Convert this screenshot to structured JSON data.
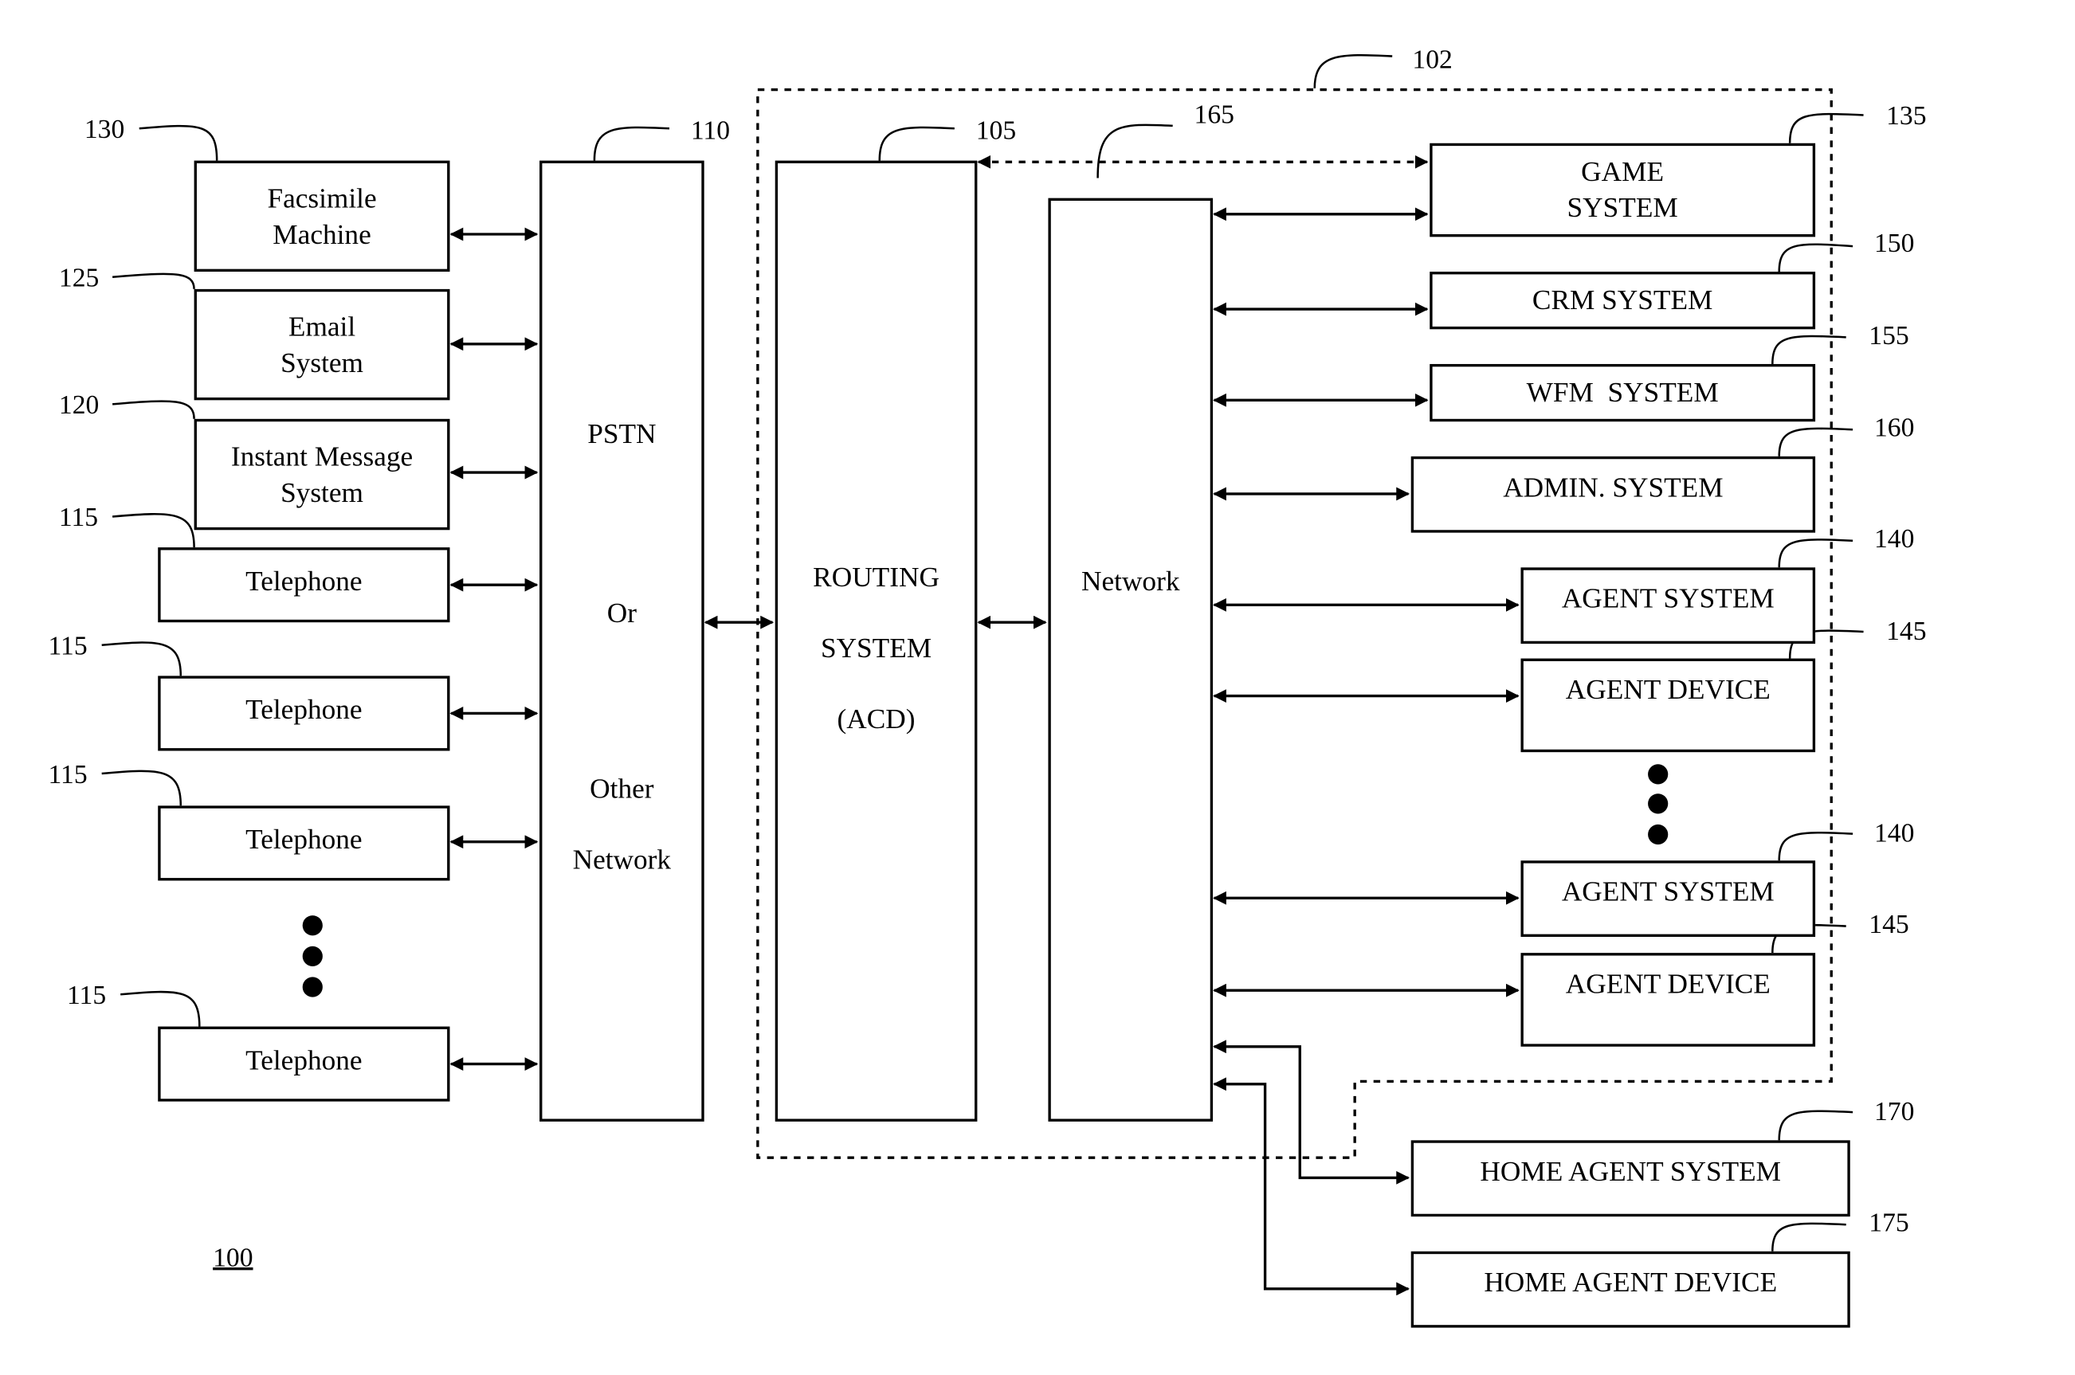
{
  "figure_label": "100",
  "boundary_ref": "102",
  "left_devices": [
    {
      "label": "Facsimile\nMachine",
      "ref": "130"
    },
    {
      "label": "Email\nSystem",
      "ref": "125"
    },
    {
      "label": "Instant Message\nSystem",
      "ref": "120"
    },
    {
      "label": "Telephone",
      "ref": "115"
    },
    {
      "label": "Telephone",
      "ref": "115"
    },
    {
      "label": "Telephone",
      "ref": "115"
    },
    {
      "label": "Telephone",
      "ref": "115"
    }
  ],
  "pstn": {
    "ref": "110",
    "lines": [
      "PSTN",
      "Or",
      "Other",
      "Network"
    ]
  },
  "routing": {
    "ref": "105",
    "lines": [
      "ROUTING",
      "SYSTEM",
      "(ACD)"
    ]
  },
  "network": {
    "ref": "165",
    "label": "Network"
  },
  "right_systems": [
    {
      "label": "GAME\nSYSTEM",
      "ref": "135"
    },
    {
      "label": "CRM SYSTEM",
      "ref": "150"
    },
    {
      "label": "WFM  SYSTEM",
      "ref": "155"
    },
    {
      "label": "ADMIN. SYSTEM",
      "ref": "160"
    },
    {
      "label": "AGENT SYSTEM",
      "ref": "140"
    },
    {
      "label": "AGENT DEVICE",
      "ref": "145"
    },
    {
      "label": "AGENT SYSTEM",
      "ref": "140"
    },
    {
      "label": "AGENT DEVICE",
      "ref": "145"
    }
  ],
  "home": [
    {
      "label": "HOME AGENT SYSTEM",
      "ref": "170"
    },
    {
      "label": "HOME AGENT DEVICE",
      "ref": "175"
    }
  ]
}
